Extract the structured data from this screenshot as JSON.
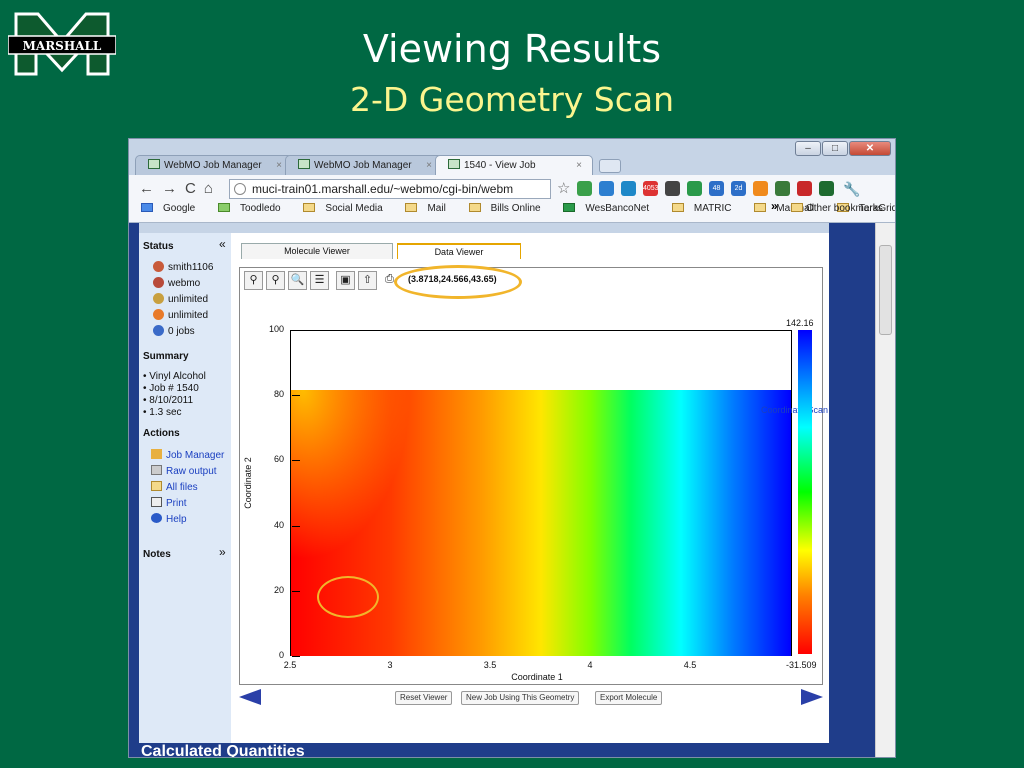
{
  "slide": {
    "logo_text": "MARSHALL",
    "title": "Viewing Results",
    "subtitle": "2-D Geometry Scan"
  },
  "browser": {
    "tabs": [
      {
        "label": "WebMO Job Manager",
        "active": false
      },
      {
        "label": "WebMO Job Manager",
        "active": false
      },
      {
        "label": "1540 - View Job",
        "active": true
      }
    ],
    "address": "muci-train01.marshall.edu/~webmo/cgi-bin/webm",
    "bookmarks": [
      "Google",
      "Toodledo",
      "Social Media",
      "Mail",
      "Bills Online",
      "WesBancoNet",
      "MATRIC",
      "Marshall",
      "TeraGrid"
    ],
    "overflow_chevron": "»",
    "other_bookmarks": "Other bookmarks",
    "ext_badges": [
      "4053",
      "48",
      "2d"
    ]
  },
  "sidebar": {
    "status_heading": "Status",
    "status_items": [
      {
        "label": "smith1106",
        "icon": "user-icon"
      },
      {
        "label": "webmo",
        "icon": "group-icon"
      },
      {
        "label": "unlimited",
        "icon": "disk-icon"
      },
      {
        "label": "unlimited",
        "icon": "clock-icon"
      },
      {
        "label": "0 jobs",
        "icon": "jobs-icon"
      }
    ],
    "summary_heading": "Summary",
    "summary_items": [
      "Vinyl Alcohol",
      "Job # 1540",
      "8/10/2011",
      "1.3 sec"
    ],
    "actions_heading": "Actions",
    "actions": [
      {
        "label": "Job Manager",
        "icon": "home-icon"
      },
      {
        "label": "Raw output",
        "icon": "document-icon"
      },
      {
        "label": "All files",
        "icon": "folder-icon"
      },
      {
        "label": "Print",
        "icon": "printer-icon"
      },
      {
        "label": "Help",
        "icon": "help-icon"
      }
    ],
    "notes_heading": "Notes",
    "collapse_glyph": "«",
    "expand_glyph": "»"
  },
  "viewer": {
    "tabs": [
      "Molecule Viewer",
      "Data Viewer"
    ],
    "active_tab": "Data Viewer",
    "coordinate_readout": "(3.8718,24.566,43.65)",
    "tool_icons": [
      "zoom-in-icon",
      "zoom-out-icon",
      "magnify-icon",
      "list-icon",
      "save-icon",
      "export-icon",
      "print-icon"
    ],
    "buttons": [
      "Reset Viewer",
      "New Job Using This Geometry",
      "Export Molecule"
    ],
    "calculated_heading": "Calculated Quantities"
  },
  "chart_data": {
    "type": "heatmap",
    "title": "",
    "legend": "Coordinate Scan",
    "xlabel": "Coordinate 1",
    "ylabel": "Coordinate 2",
    "xlim": [
      2.5,
      5.0
    ],
    "ylim": [
      0,
      100
    ],
    "x_data_range": [
      2.5,
      5.0
    ],
    "y_data_range": [
      0,
      82
    ],
    "xticks": [
      "2.5",
      "3",
      "3.5",
      "4",
      "4.5"
    ],
    "yticks": [
      "0",
      "20",
      "40",
      "60",
      "80",
      "100"
    ],
    "colorbar": {
      "max": "142.16",
      "min": "-31.509",
      "colors": [
        "#ff0000",
        "#ffff00",
        "#00ff00",
        "#00ffff",
        "#0000ff"
      ]
    }
  }
}
